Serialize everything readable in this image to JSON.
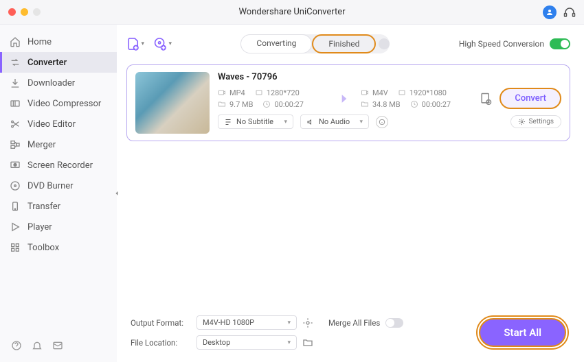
{
  "app": {
    "title": "Wondershare UniConverter"
  },
  "sidebar": {
    "items": [
      {
        "label": "Home",
        "icon": "home"
      },
      {
        "label": "Converter",
        "icon": "convert",
        "active": true
      },
      {
        "label": "Downloader",
        "icon": "download"
      },
      {
        "label": "Video Compressor",
        "icon": "compress"
      },
      {
        "label": "Video Editor",
        "icon": "scissors"
      },
      {
        "label": "Merger",
        "icon": "merge"
      },
      {
        "label": "Screen Recorder",
        "icon": "record"
      },
      {
        "label": "DVD Burner",
        "icon": "disc"
      },
      {
        "label": "Transfer",
        "icon": "transfer"
      },
      {
        "label": "Player",
        "icon": "play"
      },
      {
        "label": "Toolbox",
        "icon": "grid"
      }
    ]
  },
  "toolbar": {
    "tabs": {
      "converting": "Converting",
      "finished": "Finished"
    },
    "high_speed_label": "High Speed Conversion"
  },
  "task": {
    "title": "Waves - 70796",
    "src": {
      "format": "MP4",
      "resolution": "1280*720",
      "size": "9.7 MB",
      "duration": "00:00:27"
    },
    "dst": {
      "format": "M4V",
      "resolution": "1920*1080",
      "size": "34.8 MB",
      "duration": "00:00:27"
    },
    "subtitle": "No Subtitle",
    "audio": "No Audio",
    "settings_label": "Settings",
    "convert_label": "Convert"
  },
  "footer": {
    "output_format_label": "Output Format:",
    "output_format_value": "M4V-HD 1080P",
    "file_location_label": "File Location:",
    "file_location_value": "Desktop",
    "merge_label": "Merge All Files",
    "start_all_label": "Start All"
  }
}
